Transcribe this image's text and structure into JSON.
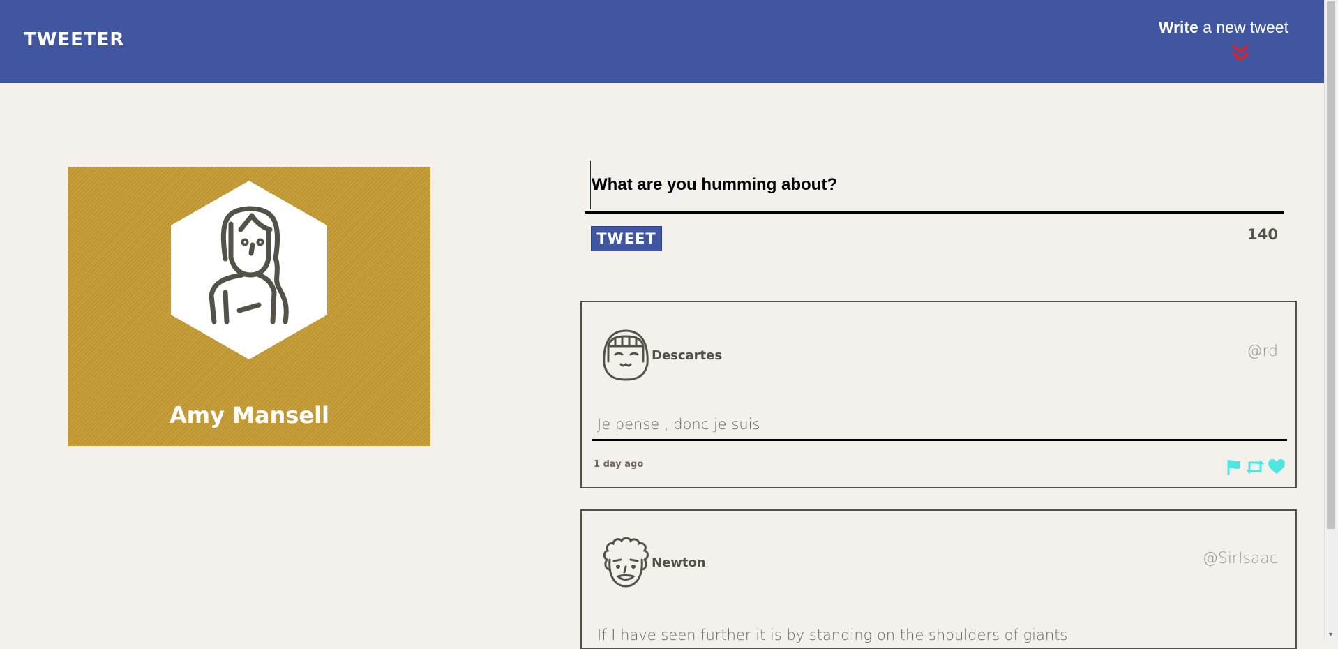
{
  "header": {
    "brand": "TWEETER",
    "write_bold": "Write",
    "write_rest": " a new tweet",
    "chevron_color": "#d8232a"
  },
  "profile": {
    "name": "Amy Mansell",
    "background_color": "#c49a32"
  },
  "composer": {
    "placeholder": "What are you humming about?",
    "tweet_button": "TWEET",
    "char_count": "140"
  },
  "tweets": [
    {
      "name": "Descartes",
      "handle": "@rd",
      "text": "Je pense , donc je suis",
      "time": "1 day ago",
      "action_icons": [
        "flag-icon",
        "retweet-icon",
        "heart-icon"
      ],
      "action_color": "#4ee6e0"
    },
    {
      "name": "Newton",
      "handle": "@SirIsaac",
      "text": "If I have seen further it is by standing on the shoulders of giants"
    }
  ],
  "colors": {
    "header_bg": "#4056a1",
    "page_bg": "#f4f1ec",
    "text": "#545149"
  }
}
